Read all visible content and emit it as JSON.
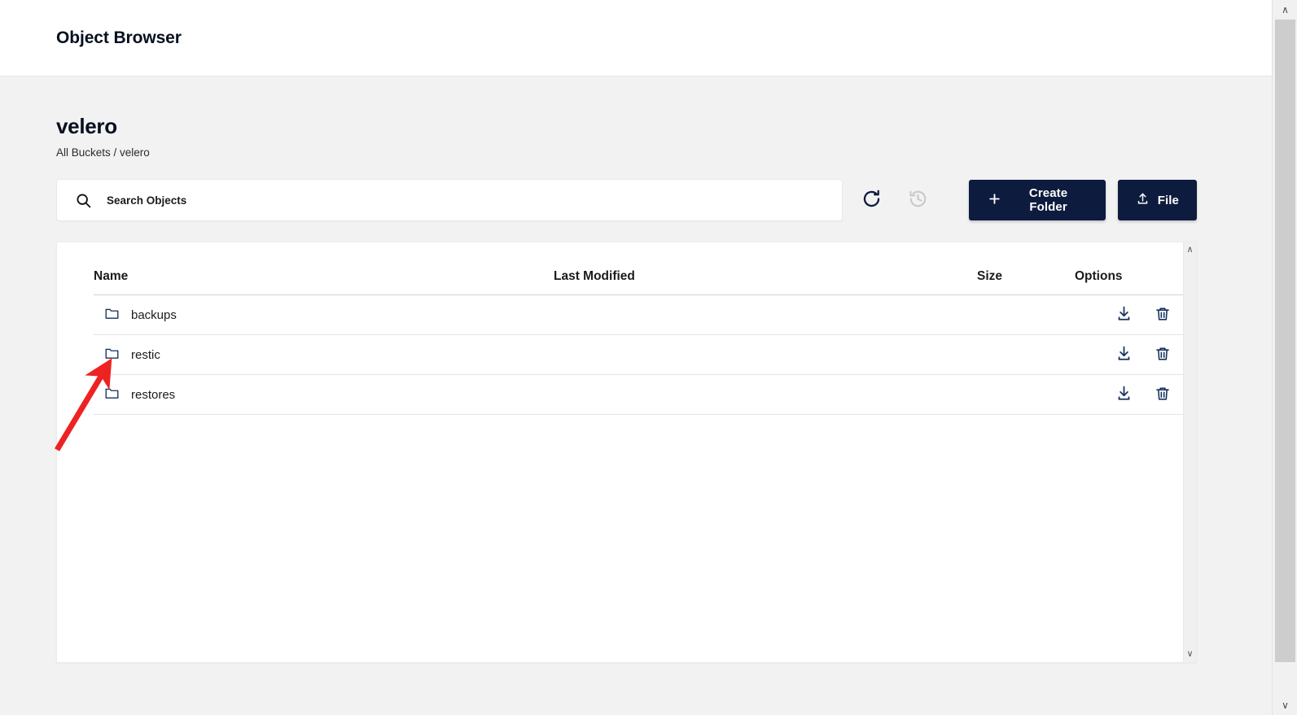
{
  "app": {
    "title": "Object Browser"
  },
  "bucket": {
    "name": "velero",
    "breadcrumb": "All Buckets / velero"
  },
  "search": {
    "placeholder": "Search Objects",
    "value": "",
    "icon": "search-icon"
  },
  "toolbar": {
    "refresh_icon": "refresh-icon",
    "history_icon": "history-icon",
    "create_folder_label": "Create Folder",
    "create_folder_icon": "plus-icon",
    "upload_file_label": "File",
    "upload_file_icon": "upload-icon"
  },
  "table": {
    "columns": [
      {
        "key": "name",
        "label": "Name"
      },
      {
        "key": "modified",
        "label": "Last Modified"
      },
      {
        "key": "size",
        "label": "Size"
      },
      {
        "key": "options",
        "label": "Options"
      }
    ],
    "rows": [
      {
        "name": "backups",
        "modified": "",
        "size": "",
        "icon": "folder-icon",
        "download_icon": "download-icon",
        "delete_icon": "trash-icon"
      },
      {
        "name": "restic",
        "modified": "",
        "size": "",
        "icon": "folder-icon",
        "download_icon": "download-icon",
        "delete_icon": "trash-icon"
      },
      {
        "name": "restores",
        "modified": "",
        "size": "",
        "icon": "folder-icon",
        "download_icon": "download-icon",
        "delete_icon": "trash-icon"
      }
    ]
  },
  "scrollbars": {
    "panel_up": "∧",
    "panel_down": "∨",
    "window_up": "∧",
    "window_down": "∨"
  },
  "annotation": {
    "type": "arrow",
    "color": "#ee2222",
    "points_to": "restic"
  },
  "colors": {
    "accent_navy": "#0d1b3e",
    "page_bg": "#f2f2f2",
    "panel_bg": "#ffffff",
    "annotation_red": "#ee2222"
  }
}
